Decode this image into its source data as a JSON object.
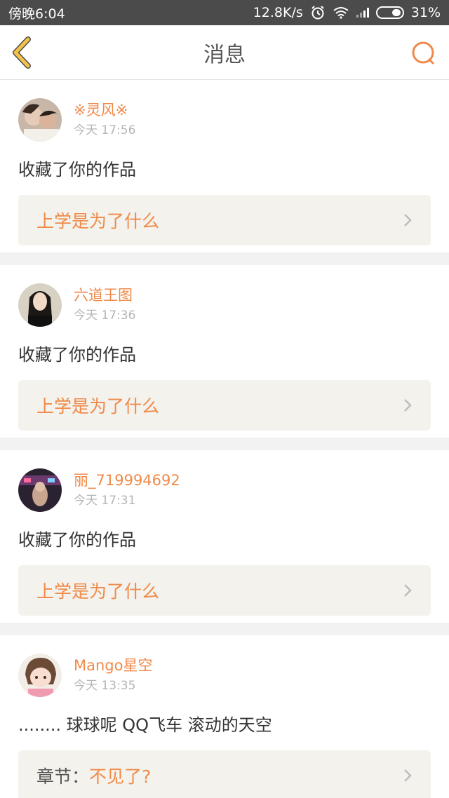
{
  "status_bar": {
    "time": "傍晚6:04",
    "speed": "12.8K/s",
    "battery": "31%"
  },
  "header": {
    "title": "消息"
  },
  "messages": [
    {
      "username": "※灵风※",
      "time": "今天 17:56",
      "action": "收藏了你的作品",
      "work_title": "上学是为了什么"
    },
    {
      "username": "六道王图",
      "time": "今天 17:36",
      "action": "收藏了你的作品",
      "work_title": "上学是为了什么"
    },
    {
      "username": "丽_719994692",
      "time": "今天 17:31",
      "action": "收藏了你的作品",
      "work_title": "上学是为了什么"
    },
    {
      "username": "Mango星空",
      "time": "今天 13:35",
      "action": "........ 球球呢 QQ飞车 滚动的天空",
      "chapter_label": "章节：",
      "work_title": "不见了?"
    }
  ],
  "colors": {
    "accent": "#f08a4a",
    "status_bar": "#4b4b4b",
    "box_bg": "#f4f2ec",
    "back_icon": "#f3c24a"
  },
  "icons": [
    "back-icon",
    "search-icon",
    "alarm-icon",
    "wifi-icon",
    "signal-icon",
    "battery-icon",
    "chevron-right-icon"
  ]
}
